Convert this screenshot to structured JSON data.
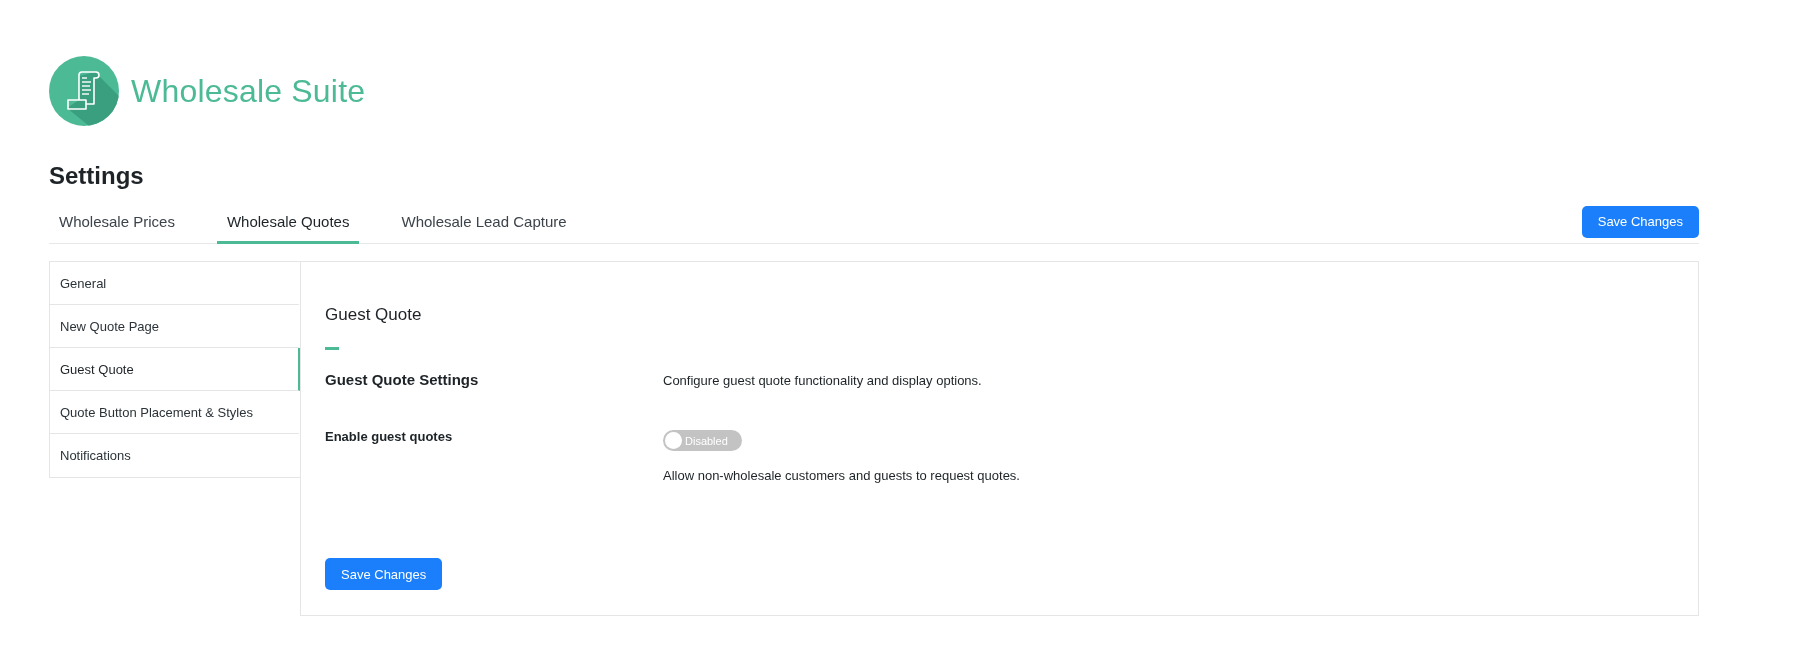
{
  "logo": {
    "text": "Wholesale Suite"
  },
  "page_title": "Settings",
  "tabs": [
    {
      "label": "Wholesale Prices",
      "selected": false
    },
    {
      "label": "Wholesale Quotes",
      "selected": true
    },
    {
      "label": "Wholesale Lead Capture",
      "selected": false
    }
  ],
  "header_button": "Save Changes",
  "sidebar": {
    "items": [
      {
        "label": "General",
        "selected": false
      },
      {
        "label": "New Quote Page",
        "selected": false
      },
      {
        "label": "Guest Quote",
        "selected": true
      },
      {
        "label": "Quote Button Placement & Styles",
        "selected": false
      },
      {
        "label": "Notifications",
        "selected": false
      }
    ]
  },
  "panel": {
    "title": "Guest Quote",
    "section": {
      "title": "Guest Quote Settings",
      "description": "Configure guest quote functionality and display options."
    },
    "fields": [
      {
        "kind": "toggle",
        "label": "Enable guest quotes",
        "on": false,
        "state_text": "Disabled",
        "help": "Allow non-wholesale customers and guests to request quotes."
      }
    ],
    "button": "Save Changes"
  }
}
